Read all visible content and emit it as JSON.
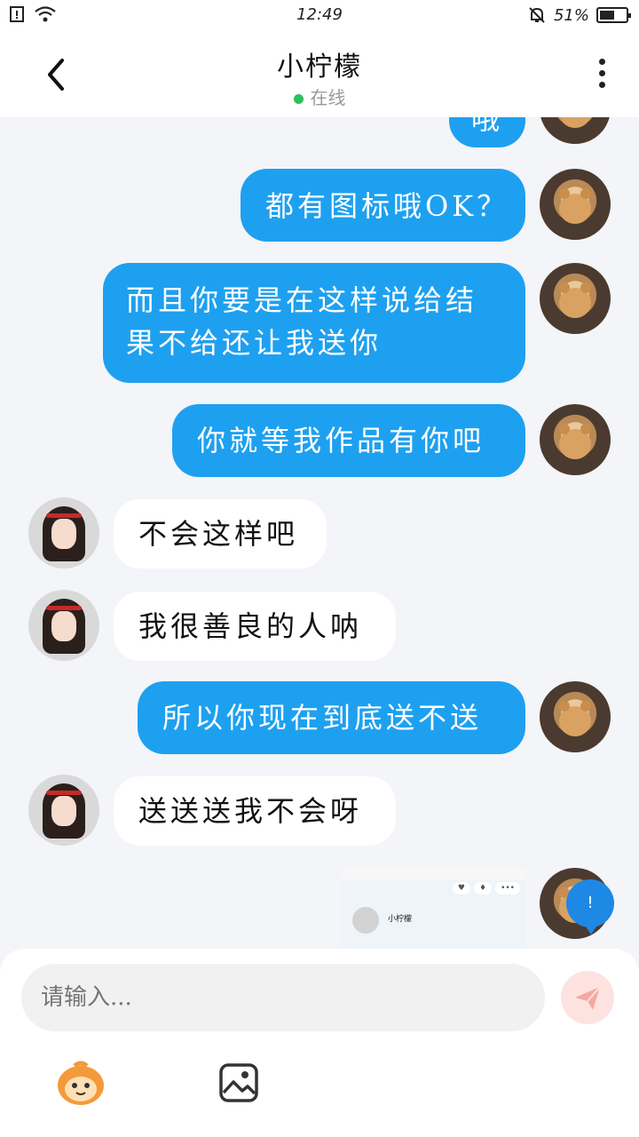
{
  "status_bar": {
    "time": "12:49",
    "battery_percent": "51%",
    "battery_level": 0.51,
    "icons": [
      "sim-alert-icon",
      "wifi-icon",
      "bell-off-icon",
      "battery-icon"
    ]
  },
  "header": {
    "title": "小柠檬",
    "status": "在线",
    "status_color": "#2bc25a"
  },
  "messages": [
    {
      "side": "out",
      "text": "哦"
    },
    {
      "side": "out",
      "text": "都有图标哦OK？"
    },
    {
      "side": "out",
      "text": "而且你要是在这样说给结果不给还让我送你"
    },
    {
      "side": "out",
      "text": "你就等我作品有你吧"
    },
    {
      "side": "in",
      "text": "不会这样吧"
    },
    {
      "side": "in",
      "text": "我很善良的人呐"
    },
    {
      "side": "out",
      "text": "所以你现在到底送不送"
    },
    {
      "side": "in",
      "text": "送送送我不会呀"
    },
    {
      "side": "out",
      "type": "image",
      "caption": "小柠檬"
    }
  ],
  "badge": {
    "text": "!"
  },
  "input": {
    "placeholder": "请输入..."
  },
  "toolbar": {
    "icons": [
      "emoji-icon",
      "image-icon",
      "send-icon"
    ]
  },
  "colors": {
    "outgoing_bubble": "#1ea0f0",
    "incoming_bubble": "#ffffff",
    "background": "#f3f5f8"
  }
}
